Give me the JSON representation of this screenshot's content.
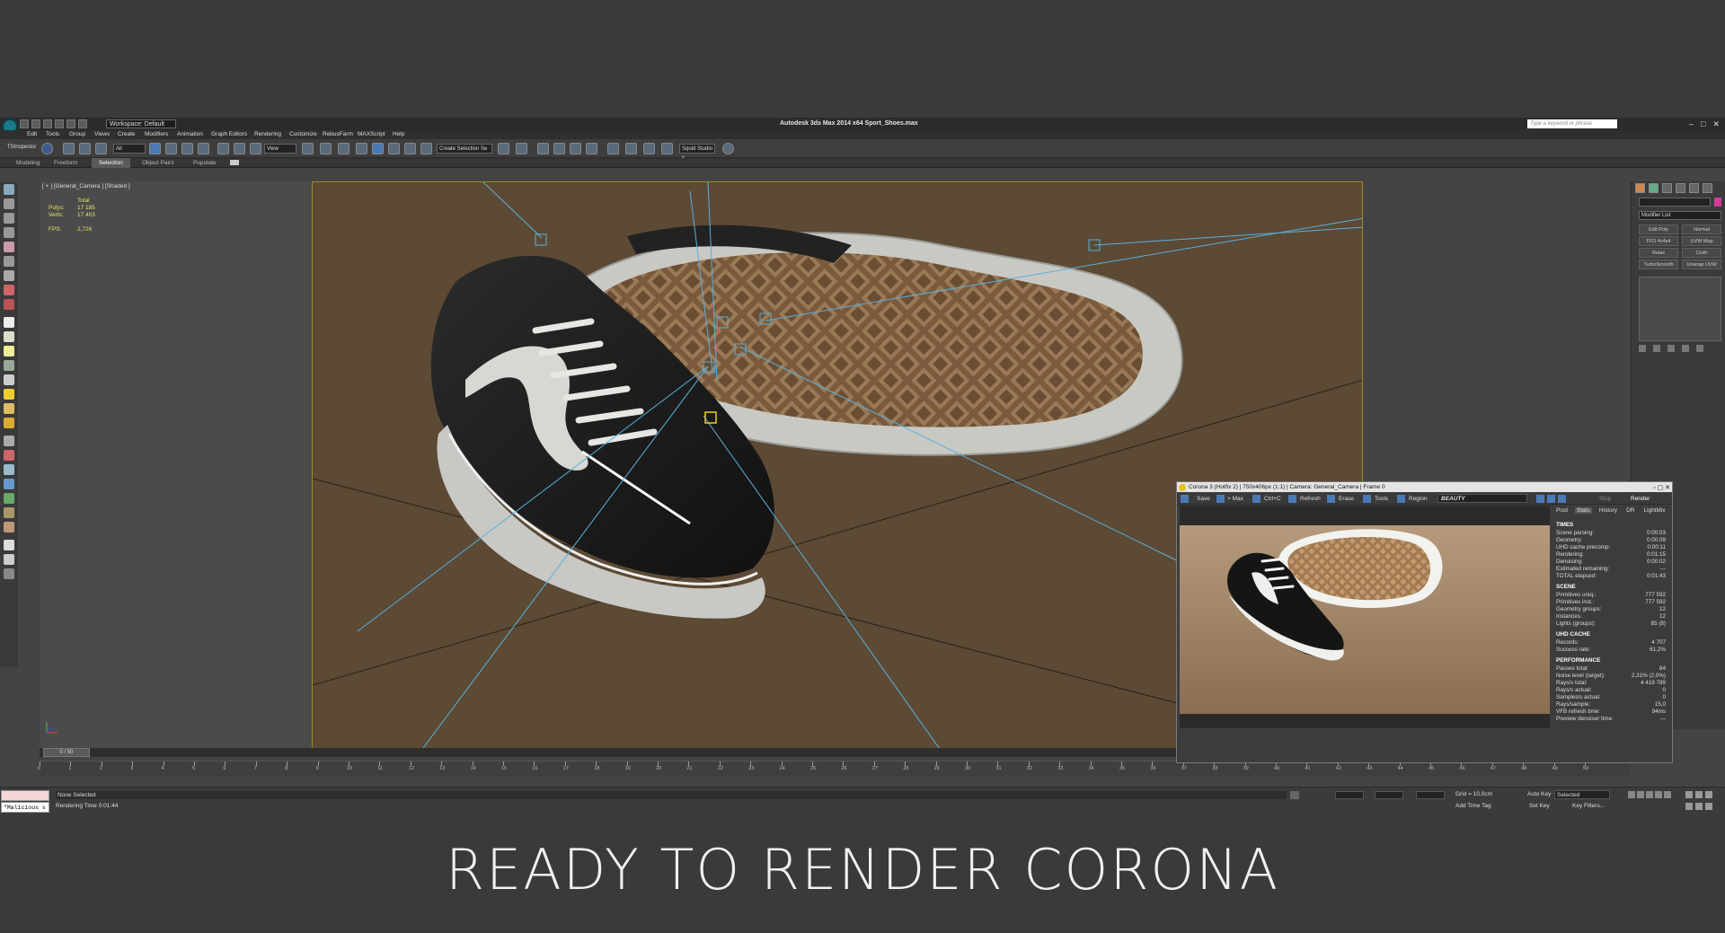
{
  "titlebar": {
    "workspace": "Workspace: Default",
    "title": "Autodesk 3ds Max  2014 x64    Sport_Shoes.max",
    "search_placeholder": "Type a keyword or phrase"
  },
  "menu": [
    "Edit",
    "Tools",
    "Group",
    "Views",
    "Create",
    "Modifiers",
    "Animation",
    "Graph Editors",
    "Rendering",
    "Customize",
    "RebusFarm",
    "MAXScript",
    "Help"
  ],
  "toolbar": {
    "left_label": "TSInspector",
    "filter_value": "All",
    "view_value": "View",
    "selection_set_placeholder": "Create Selection Se",
    "squid_label": "Squid Studio v"
  },
  "ribbon_tabs": [
    "Modeling",
    "Freeform",
    "Selection",
    "Object Paint",
    "Populate"
  ],
  "ribbon_active": "Selection",
  "viewport": {
    "label": "[ + ] [General_Camera ] [Shaded ]",
    "stats": {
      "header": "Total",
      "polys_label": "Polys:",
      "polys_value": "17 185",
      "verts_label": "Verts:",
      "verts_value": "17 403",
      "fps_label": "FPS:",
      "fps_value": "2,726"
    }
  },
  "command_panel": {
    "modifier_list": "Modifier List",
    "buttons": [
      [
        "Edit Poly",
        "Normal"
      ],
      [
        "FFD 4x4x4",
        "UVW Map"
      ],
      [
        "Relax",
        "Cloth"
      ],
      [
        "TurboSmooth",
        "Unwrap UVW"
      ]
    ]
  },
  "timeline": {
    "slider": "0 / 50",
    "ticks": [
      "0",
      "1",
      "2",
      "3",
      "4",
      "5",
      "6",
      "7",
      "8",
      "9",
      "10",
      "11",
      "12",
      "13",
      "14",
      "15",
      "16",
      "17",
      "18",
      "19",
      "20",
      "21",
      "22",
      "23",
      "24",
      "25",
      "26",
      "27",
      "28",
      "29",
      "30",
      "31",
      "32",
      "33",
      "34",
      "35",
      "36",
      "37",
      "38",
      "39",
      "40",
      "41",
      "42",
      "43",
      "44",
      "45",
      "46",
      "47",
      "48",
      "49",
      "50"
    ]
  },
  "status": {
    "maxscript_text": "\"Malicious s",
    "selection": "None Selected",
    "render_time": "Rendering Time  0:01:44",
    "grid": "Grid = 10,0cm",
    "add_time_tag": "Add Time Tag",
    "auto_key": "Auto Key",
    "auto_key_value": "Selected",
    "set_key": "Set Key",
    "key_filters": "Key Filters..."
  },
  "corona": {
    "title": "Corona 3 (Hotfix 2) | 750x406px (1:1) | Camera: General_Camera | Frame 0",
    "toolbar": [
      "Save",
      "> Max",
      "Ctrl+C",
      "Refresh",
      "Erase",
      "Tools",
      "Region",
      "BEAUTY"
    ],
    "stop": "Stop",
    "render": "Render",
    "tabs": [
      "Post",
      "Stats",
      "History",
      "DR",
      "LightMix"
    ],
    "active_tab": "Stats",
    "sections": [
      {
        "title": "TIMES",
        "rows": [
          [
            "Scene parsing:",
            "0:00:03"
          ],
          [
            "Geometry:",
            "0:00:09"
          ],
          [
            "UHD cache precomp:",
            "0:00:11"
          ],
          [
            "Rendering:",
            "0:01:15"
          ],
          [
            "Denoising:",
            "0:00:02"
          ],
          [
            "Estimated remaining:",
            "---"
          ],
          [
            "TOTAL elapsed:",
            "0:01:43"
          ]
        ]
      },
      {
        "title": "SCENE",
        "rows": [
          [
            "Primitives uniq.:",
            "777 592"
          ],
          [
            "Primitives inst.:",
            "777 592"
          ],
          [
            "Geometry groups:",
            "12"
          ],
          [
            "Instances:",
            "12"
          ],
          [
            "Lights (groups):",
            "85 (8)"
          ]
        ]
      },
      {
        "title": "UHD CACHE",
        "rows": [
          [
            "Records:",
            "4 707"
          ],
          [
            "Success rate:",
            "61,2%"
          ]
        ]
      },
      {
        "title": "PERFORMANCE",
        "rows": [
          [
            "Passes total:",
            "84"
          ],
          [
            "Noise level (target):",
            "2,31% (2,0%)"
          ],
          [
            "Rays/s total:",
            "4 419 789"
          ],
          [
            "Rays/s actual:",
            "0"
          ],
          [
            "Samples/s actual:",
            "0"
          ],
          [
            "Rays/sample:",
            "15,0"
          ],
          [
            "VFB refresh time:",
            "94ms"
          ],
          [
            "Preview denoiser time:",
            "---"
          ]
        ]
      }
    ]
  },
  "caption": "READY TO RENDER CORONA",
  "colors": {
    "viewport_bg": "#5c4a35",
    "safe_frame": "#9a8a30",
    "stats_text": "#e8e36a"
  }
}
